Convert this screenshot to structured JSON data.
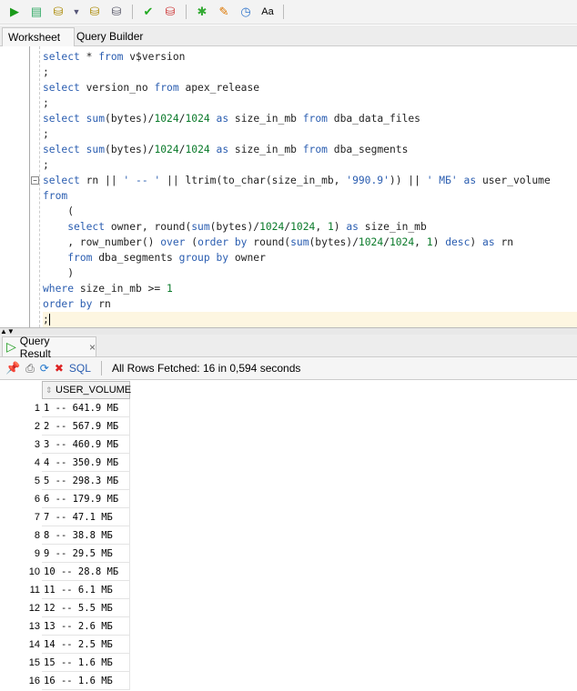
{
  "toolbar": {
    "icons": [
      "run-statement-icon",
      "run-script-icon",
      "commit-icon",
      "dropdown-icon",
      "explain-plan-icon",
      "autotrace-icon",
      "commit-db-icon",
      "rollback-db-icon",
      "sql-tuning-icon",
      "clear-icon",
      "history-icon",
      "format-case-icon"
    ]
  },
  "tabs": {
    "worksheet": "Worksheet",
    "query_builder": "Query Builder"
  },
  "code": [
    [
      [
        "kw",
        "select"
      ],
      [
        "id",
        " * "
      ],
      [
        "kw",
        "from"
      ],
      [
        "id",
        " v$version"
      ]
    ],
    [
      [
        "id",
        ";"
      ]
    ],
    [
      [
        "kw",
        "select"
      ],
      [
        "id",
        " version_no "
      ],
      [
        "kw",
        "from"
      ],
      [
        "id",
        " apex_release"
      ]
    ],
    [
      [
        "id",
        ";"
      ]
    ],
    [
      [
        "kw",
        "select"
      ],
      [
        "id",
        " "
      ],
      [
        "kw",
        "sum"
      ],
      [
        "id",
        "(bytes)/"
      ],
      [
        "num",
        "1024"
      ],
      [
        "id",
        "/"
      ],
      [
        "num",
        "1024"
      ],
      [
        "id",
        " "
      ],
      [
        "kw",
        "as"
      ],
      [
        "id",
        " size_in_mb "
      ],
      [
        "kw",
        "from"
      ],
      [
        "id",
        " dba_data_files"
      ]
    ],
    [
      [
        "id",
        ";"
      ]
    ],
    [
      [
        "kw",
        "select"
      ],
      [
        "id",
        " "
      ],
      [
        "kw",
        "sum"
      ],
      [
        "id",
        "(bytes)/"
      ],
      [
        "num",
        "1024"
      ],
      [
        "id",
        "/"
      ],
      [
        "num",
        "1024"
      ],
      [
        "id",
        " "
      ],
      [
        "kw",
        "as"
      ],
      [
        "id",
        " size_in_mb "
      ],
      [
        "kw",
        "from"
      ],
      [
        "id",
        " dba_segments"
      ]
    ],
    [
      [
        "id",
        ";"
      ]
    ],
    [
      [
        "kw",
        "select"
      ],
      [
        "id",
        " rn || "
      ],
      [
        "str",
        "' -- '"
      ],
      [
        "id",
        " || ltrim(to_char(size_in_mb, "
      ],
      [
        "str",
        "'990.9'"
      ],
      [
        "id",
        ")) || "
      ],
      [
        "str",
        "' МБ'"
      ],
      [
        "id",
        " "
      ],
      [
        "kw",
        "as"
      ],
      [
        "id",
        " user_volume"
      ]
    ],
    [
      [
        "kw",
        "from"
      ]
    ],
    [
      [
        "id",
        "    ("
      ]
    ],
    [
      [
        "id",
        "    "
      ],
      [
        "kw",
        "select"
      ],
      [
        "id",
        " owner, round("
      ],
      [
        "kw",
        "sum"
      ],
      [
        "id",
        "(bytes)/"
      ],
      [
        "num",
        "1024"
      ],
      [
        "id",
        "/"
      ],
      [
        "num",
        "1024"
      ],
      [
        "id",
        ", "
      ],
      [
        "num",
        "1"
      ],
      [
        "id",
        ") "
      ],
      [
        "kw",
        "as"
      ],
      [
        "id",
        " size_in_mb"
      ]
    ],
    [
      [
        "id",
        "    , row_number() "
      ],
      [
        "kw",
        "over"
      ],
      [
        "id",
        " ("
      ],
      [
        "kw",
        "order by"
      ],
      [
        "id",
        " round("
      ],
      [
        "kw",
        "sum"
      ],
      [
        "id",
        "(bytes)/"
      ],
      [
        "num",
        "1024"
      ],
      [
        "id",
        "/"
      ],
      [
        "num",
        "1024"
      ],
      [
        "id",
        ", "
      ],
      [
        "num",
        "1"
      ],
      [
        "id",
        ") "
      ],
      [
        "kw",
        "desc"
      ],
      [
        "id",
        ") "
      ],
      [
        "kw",
        "as"
      ],
      [
        "id",
        " rn"
      ]
    ],
    [
      [
        "id",
        "    "
      ],
      [
        "kw",
        "from"
      ],
      [
        "id",
        " dba_segments "
      ],
      [
        "kw",
        "group by"
      ],
      [
        "id",
        " owner"
      ]
    ],
    [
      [
        "id",
        "    )"
      ]
    ],
    [
      [
        "kw",
        "where"
      ],
      [
        "id",
        " size_in_mb >= "
      ],
      [
        "num",
        "1"
      ]
    ],
    [
      [
        "kw",
        "order by"
      ],
      [
        "id",
        " rn"
      ]
    ],
    [
      [
        "id",
        ";"
      ]
    ]
  ],
  "result": {
    "tab_label": "Query Result",
    "close": "×",
    "sql_label": "SQL",
    "status": "All Rows Fetched: 16 in 0,594 seconds",
    "column": "USER_VOLUME",
    "rows": [
      "1 -- 641.9 МБ",
      "2 -- 567.9 МБ",
      "3 -- 460.9 МБ",
      "4 -- 350.9 МБ",
      "5 -- 298.3 МБ",
      "6 -- 179.9 МБ",
      "7 -- 47.1 МБ",
      "8 -- 38.8 МБ",
      "9 -- 29.5 МБ",
      "10 -- 28.8 МБ",
      "11 -- 6.1 МБ",
      "12 -- 5.5 МБ",
      "13 -- 2.6 МБ",
      "14 -- 2.5 МБ",
      "15 -- 1.6 МБ",
      "16 -- 1.6 МБ"
    ]
  }
}
